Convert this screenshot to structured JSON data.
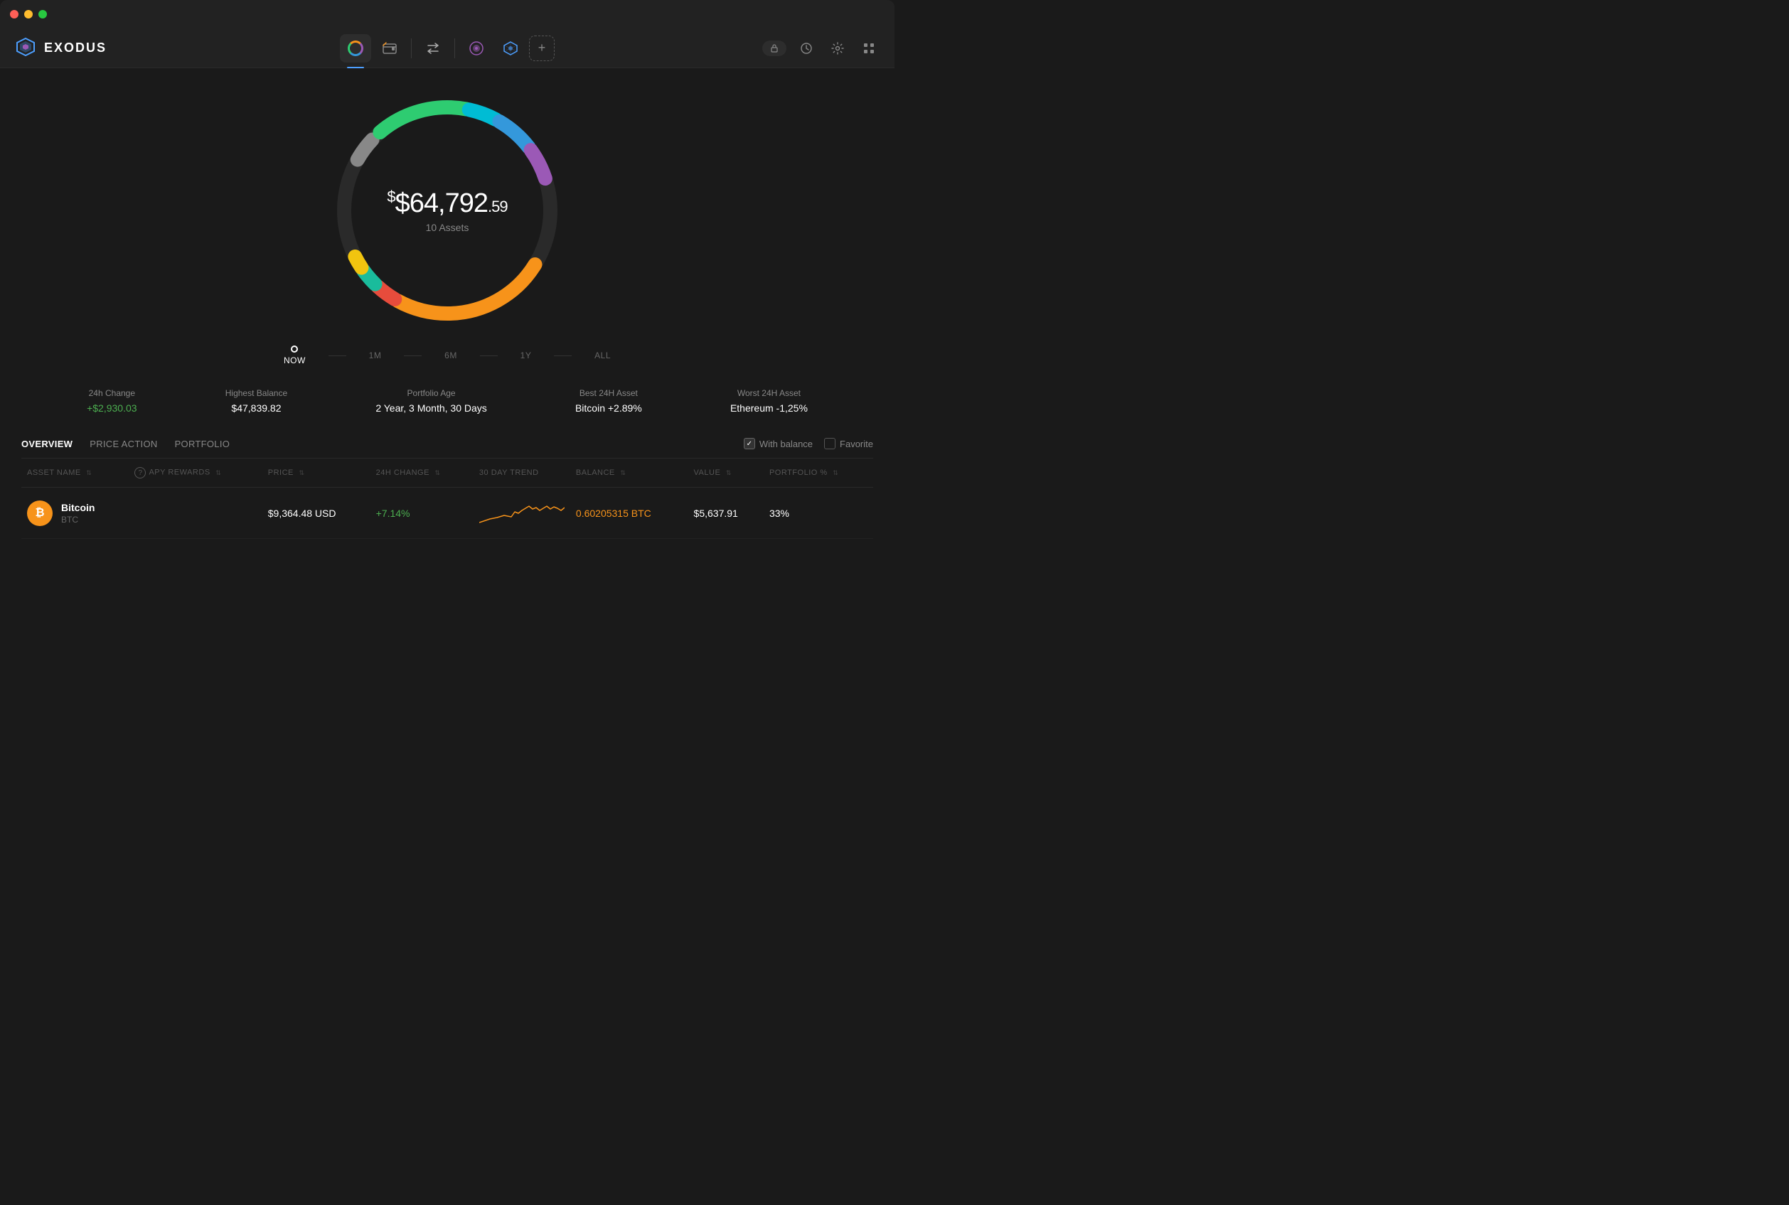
{
  "titleBar": {
    "buttons": [
      "close",
      "minimize",
      "maximize"
    ]
  },
  "navbar": {
    "logo": {
      "text": "EXODUS"
    },
    "tabs": [
      {
        "id": "portfolio",
        "label": "Portfolio",
        "icon": "portfolio-icon",
        "active": true
      },
      {
        "id": "wallet",
        "label": "Wallet",
        "icon": "wallet-icon",
        "active": false
      },
      {
        "id": "exchange",
        "label": "Exchange",
        "icon": "exchange-icon",
        "active": false
      },
      {
        "id": "nft",
        "label": "NFT",
        "icon": "nft-icon",
        "active": false
      },
      {
        "id": "web3",
        "label": "Web3",
        "icon": "web3-icon",
        "active": false
      }
    ],
    "addTab": "+",
    "rightIcons": [
      "lock",
      "history",
      "settings",
      "grid"
    ]
  },
  "donut": {
    "amount": "$64,792",
    "cents": ".59",
    "assets_label": "10 Assets"
  },
  "timeline": {
    "items": [
      {
        "label": "NOW",
        "active": true
      },
      {
        "label": "1M",
        "active": false
      },
      {
        "label": "6M",
        "active": false
      },
      {
        "label": "1Y",
        "active": false
      },
      {
        "label": "ALL",
        "active": false
      }
    ]
  },
  "stats": [
    {
      "label": "24h Change",
      "value": "+$2,930.03",
      "type": "positive"
    },
    {
      "label": "Highest Balance",
      "value": "$47,839.82",
      "type": "normal"
    },
    {
      "label": "Portfolio Age",
      "value": "2 Year, 3 Month, 30 Days",
      "type": "normal"
    },
    {
      "label": "Best 24H Asset",
      "value": "Bitcoin +2.89%",
      "type": "normal"
    },
    {
      "label": "Worst 24H Asset",
      "value": "Ethereum -1,25%",
      "type": "normal"
    }
  ],
  "tableTabs": [
    {
      "label": "OVERVIEW",
      "active": true
    },
    {
      "label": "PRICE ACTION",
      "active": false
    },
    {
      "label": "PORTFOLIO",
      "active": false
    }
  ],
  "tableFilters": [
    {
      "label": "With balance",
      "checked": true
    },
    {
      "label": "Favorite",
      "checked": false
    }
  ],
  "tableHeaders": [
    {
      "label": "ASSET NAME",
      "sortable": true
    },
    {
      "label": "APY REWARDS",
      "sortable": true,
      "help": true
    },
    {
      "label": "PRICE",
      "sortable": true
    },
    {
      "label": "24H CHANGE",
      "sortable": true
    },
    {
      "label": "30 DAY TREND",
      "sortable": false
    },
    {
      "label": "BALANCE",
      "sortable": true
    },
    {
      "label": "VALUE",
      "sortable": true
    },
    {
      "label": "PORTFOLIO %",
      "sortable": true
    }
  ],
  "tableRows": [
    {
      "name": "Bitcoin",
      "symbol": "BTC",
      "icon": "₿",
      "iconBg": "#f7931a",
      "apy": "",
      "price": "$9,364.48 USD",
      "change24h": "+7.14%",
      "changeType": "positive",
      "balance": "0.60205315 BTC",
      "balanceType": "gold",
      "value": "$5,637.91",
      "portfolio": "33%"
    }
  ],
  "colors": {
    "bg": "#1a1a1a",
    "surface": "#222222",
    "accent": "#4d9fff",
    "positive": "#4caf50",
    "negative": "#f44336",
    "bitcoin": "#f7931a",
    "border": "#2a2a2a"
  }
}
